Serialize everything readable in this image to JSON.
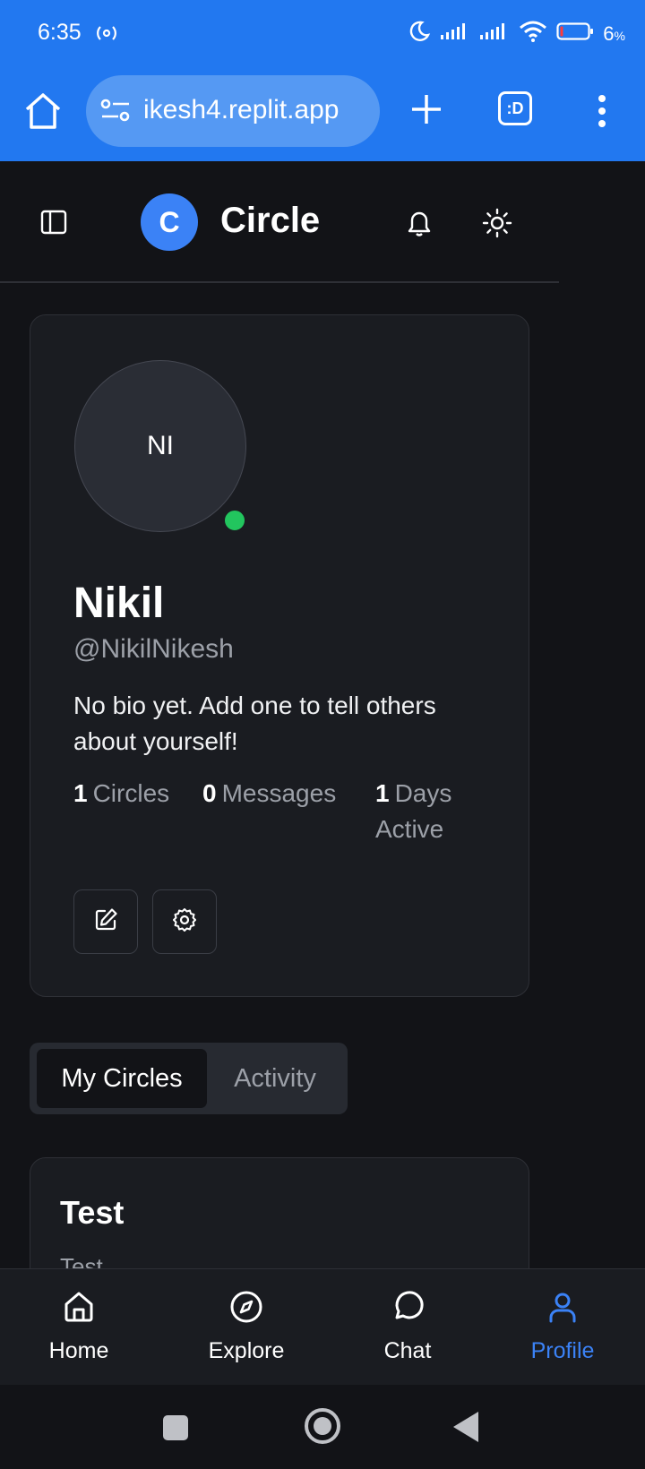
{
  "status_bar": {
    "time": "6:35",
    "battery_percent": "6",
    "battery_unit": "%"
  },
  "browser": {
    "url": "ikesh4.replit.app",
    "tabs_label": ":D"
  },
  "header": {
    "logo_letter": "C",
    "title": "Circle"
  },
  "profile": {
    "avatar_initials": "NI",
    "name": "Nikil",
    "handle": "@NikilNikesh",
    "bio": "No bio yet. Add one to tell others about yourself!",
    "stats": {
      "circles": {
        "value": "1",
        "label": "Circles"
      },
      "messages": {
        "value": "0",
        "label": "Messages"
      },
      "days_active": {
        "value": "1",
        "label": "Days Active"
      }
    },
    "online_color": "#22c55e"
  },
  "tabs": {
    "my_circles": "My Circles",
    "activity": "Activity"
  },
  "circles": [
    {
      "title": "Test",
      "description": "Test"
    }
  ],
  "bottom_nav": {
    "home": "Home",
    "explore": "Explore",
    "chat": "Chat",
    "profile": "Profile",
    "active": "profile"
  },
  "colors": {
    "browser_bar": "#2278f0",
    "accent": "#3b82f6",
    "background": "#121317",
    "card": "#1a1c21"
  },
  "icons": {
    "home": "home-icon",
    "explore": "compass-icon",
    "chat": "chat-bubble-icon",
    "profile": "user-icon",
    "edit": "edit-icon",
    "settings": "gear-icon",
    "notifications": "bell-icon",
    "theme": "sun-icon",
    "sidebar": "sidebar-icon"
  }
}
